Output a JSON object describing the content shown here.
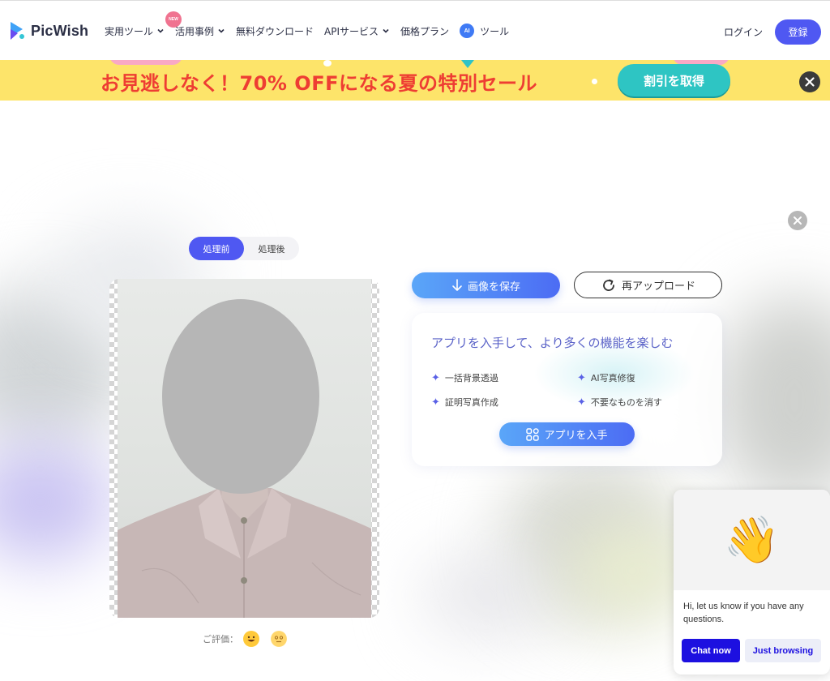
{
  "header": {
    "logo_text": "PicWish",
    "nav": [
      {
        "label": "実用ツール",
        "has_chevron": true
      },
      {
        "label": "活用事例",
        "has_chevron": true
      },
      {
        "label": "無料ダウンロード",
        "has_chevron": false
      },
      {
        "label": "APIサービス",
        "has_chevron": true
      },
      {
        "label": "価格プラン",
        "has_chevron": false
      },
      {
        "label": "ツール",
        "has_chevron": false
      }
    ],
    "new_badge": "NEW",
    "ai_badge": "AI",
    "login_label": "ログイン",
    "register_label": "登録"
  },
  "promo": {
    "text": "お見逃しなく！70% OFFになる夏の特別セール",
    "button_label": "割引を取得"
  },
  "editor": {
    "toggle": {
      "before_label": "処理前",
      "after_label": "処理後",
      "active": "before"
    },
    "rating_label": "ご評価：",
    "save_label": "画像を保存",
    "reupload_label": "再アップロード"
  },
  "app_card": {
    "title": "アプリを入手して、より多くの機能を楽しむ",
    "features": [
      "一括背景透過",
      "AI写真修復",
      "証明写真作成",
      "不要なものを消す"
    ],
    "button_label": "アプリを入手"
  },
  "chat": {
    "emoji": "👋",
    "message": "Hi, let us know if you have any questions.",
    "chat_now_label": "Chat now",
    "just_browsing_label": "Just browsing"
  },
  "colors": {
    "brand": "#4f58f2",
    "promo_bg": "#fde46a",
    "promo_text": "#ee3d33",
    "promo_button": "#2ec5c3",
    "chat_primary": "#1d10e0"
  }
}
